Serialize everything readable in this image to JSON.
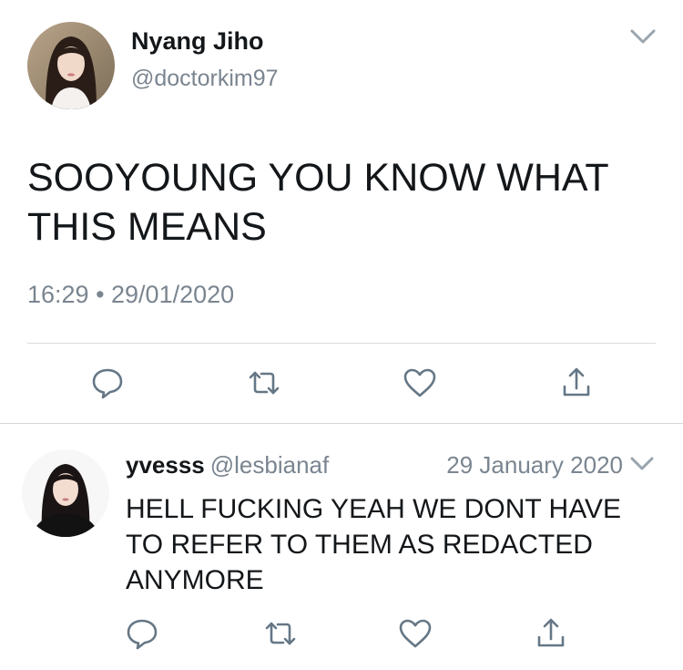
{
  "main_tweet": {
    "display_name": "Nyang Jiho",
    "handle": "@doctorkim97",
    "text": "SOOYOUNG YOU KNOW WHAT THIS MEANS",
    "timestamp": "16:29 • 29/01/2020",
    "menu_icon": "chevron-down-icon",
    "actions": [
      "reply-icon",
      "retweet-icon",
      "like-icon",
      "share-icon"
    ]
  },
  "reply": {
    "display_name": "yvesss",
    "handle": "@lesbianaf",
    "date": "29 January 2020",
    "text": "HELL FUCKING YEAH WE DONT HAVE TO REFER TO THEM AS REDACTED ANYMORE",
    "menu_icon": "chevron-down-icon",
    "actions": [
      "reply-icon",
      "retweet-icon",
      "like-icon",
      "share-icon"
    ]
  },
  "colors": {
    "text_primary": "#14171a",
    "text_secondary": "#7a8590",
    "icon_gray": "#657786",
    "divider": "#d9dde0"
  }
}
